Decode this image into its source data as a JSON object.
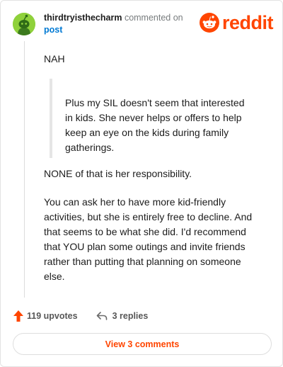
{
  "header": {
    "username": "thirdtryisthecharm",
    "action_text": "commented on",
    "post_link": "post",
    "logo_text": "reddit"
  },
  "comment": {
    "opening": "NAH",
    "quote": "Plus my SIL doesn't seem that interested in kids. She never helps or offers to help keep an eye on the kids during family gatherings.",
    "paragraph_2": "NONE of that is her responsibility.",
    "paragraph_3": "You can ask her to have more kid-friendly activities, but she is entirely free to decline. And that seems to be what she did. I'd recommend that YOU plan some outings and invite friends rather than putting that planning on someone else."
  },
  "footer": {
    "upvotes": "119 upvotes",
    "replies": "3 replies",
    "view_comments": "View 3 comments"
  },
  "colors": {
    "brand": "#ff4500",
    "link": "#0079d3",
    "avatar": "#8fd13b"
  }
}
